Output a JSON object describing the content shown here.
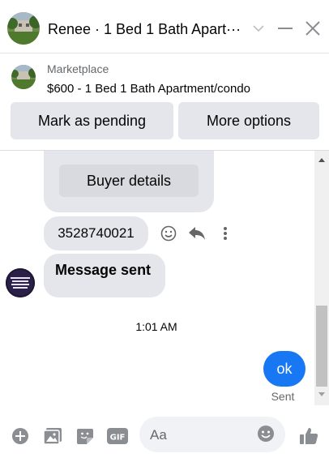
{
  "header": {
    "title": "Renee · 1 Bed 1 Bath Apart···"
  },
  "marketplace": {
    "label": "Marketplace",
    "listing": "$600 - 1 Bed 1 Bath Apartment/condo",
    "mark_pending_label": "Mark as pending",
    "more_options_label": "More options"
  },
  "chat": {
    "buyer_details_label": "Buyer details",
    "phone_message": "3528740021",
    "status_message": "Message sent",
    "timestamp": "1:01 AM",
    "my_message": "ok",
    "sent_status": "Sent",
    "sender_avatar_text": "DANGEROUS MOTIVATED PEOPLE WHO TRUST GOD"
  },
  "composer": {
    "placeholder": "Aa"
  },
  "colors": {
    "accent": "#1877f2",
    "bubble_grey": "#e4e6eb",
    "icon_grey": "#8a8d91"
  }
}
